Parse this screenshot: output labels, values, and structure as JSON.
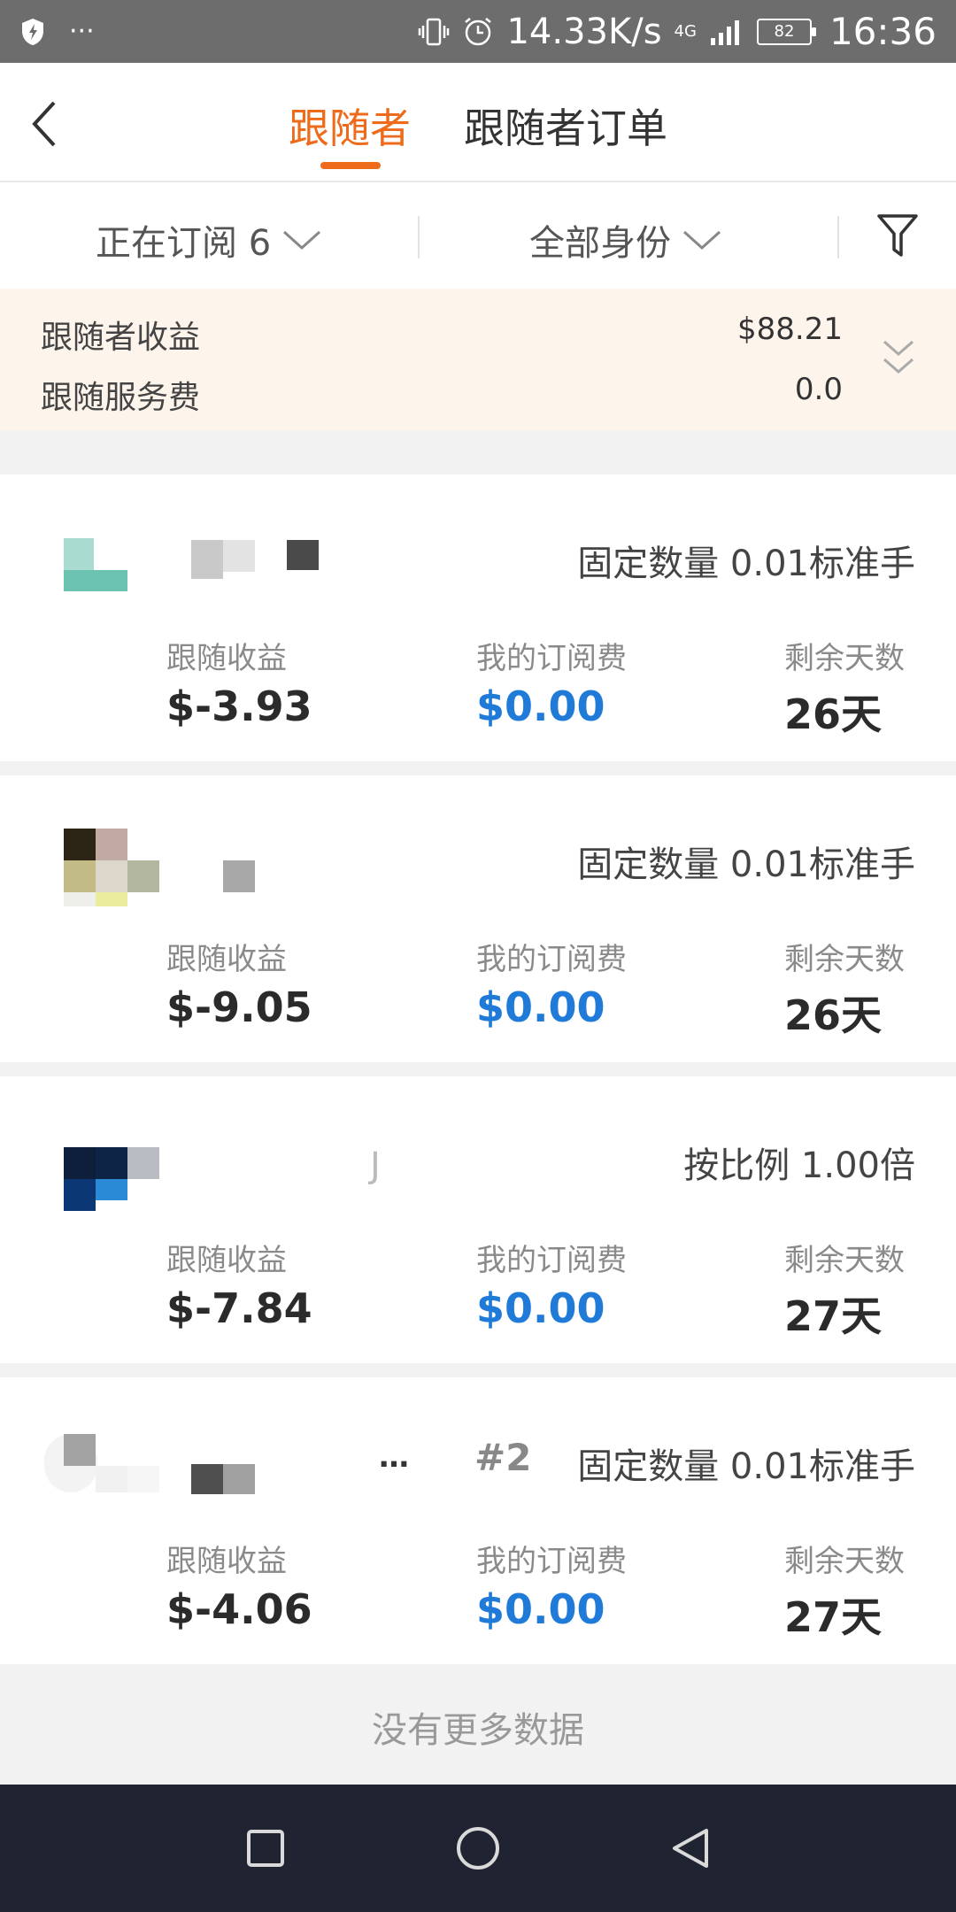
{
  "status_bar": {
    "net_speed": "14.33K/s",
    "network": "4G",
    "battery": "82",
    "time": "16:36",
    "more": "···"
  },
  "header": {
    "tabs": [
      {
        "label": "跟随者",
        "active": true
      },
      {
        "label": "跟随者订单",
        "active": false
      }
    ],
    "accent_color": "#ee6b1b"
  },
  "filters": {
    "subscription": "正在订阅 6",
    "identity": "全部身份"
  },
  "summary": {
    "earnings_label": "跟随者收益",
    "earnings_value": "$88.21",
    "fee_label": "跟随服务费",
    "fee_value": "0.0"
  },
  "labels": {
    "follow_earnings": "跟随收益",
    "my_fee": "我的订阅费",
    "days_left": "剩余天数"
  },
  "followers": [
    {
      "mode": "固定数量 0.01标准手",
      "tag": "",
      "name_fragment": "",
      "earnings": "$-3.93",
      "fee": "$0.00",
      "days": "26天"
    },
    {
      "mode": "固定数量 0.01标准手",
      "tag": "",
      "name_fragment": "",
      "earnings": "$-9.05",
      "fee": "$0.00",
      "days": "26天"
    },
    {
      "mode": "按比例 1.00倍",
      "tag": "",
      "name_fragment": "J",
      "earnings": "$-7.84",
      "fee": "$0.00",
      "days": "27天"
    },
    {
      "mode": "固定数量 0.01标准手",
      "tag": "#2",
      "name_fragment": "…",
      "earnings": "$-4.06",
      "fee": "$0.00",
      "days": "27天"
    }
  ],
  "footer": {
    "no_more": "没有更多数据"
  },
  "colors": {
    "blue_value": "#1f7ad8",
    "summary_bg": "#fdf4ec",
    "navbar_bg": "#202332"
  }
}
